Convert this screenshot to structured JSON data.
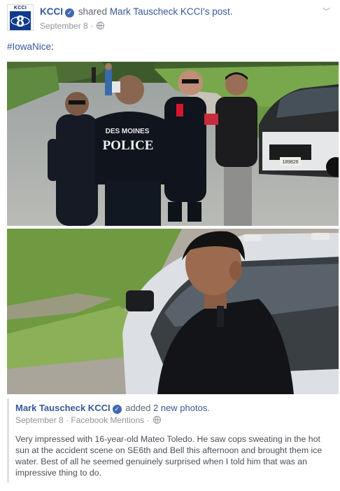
{
  "header": {
    "page_logo_text": "KCCI",
    "page_name": "KCCI",
    "shared_text": "shared",
    "author_name_part1": "Mark Tauscheck",
    "author_name_part2": "KCCI",
    "post_suffix": "'s post.",
    "date": "September 8",
    "separator": "·",
    "privacy_icon": "globe-icon",
    "menu_icon": "chevron-down-icon"
  },
  "post": {
    "hashtag": "#IowaNice",
    "hashtag_suffix": ":"
  },
  "photos": [
    {
      "alt": "Police officers in Des Moines Police uniforms receiving a drink from a teenager near police cars and caution tape",
      "sign_text": "DES MOINES",
      "sign_text2": "POLICE",
      "plate": "189826"
    },
    {
      "alt": "Close-up of a teenager in a black shirt standing next to a police car"
    }
  ],
  "shared_post": {
    "author": "Mark Tauscheck KCCI",
    "added_text": "added",
    "photos_link": "2 new photos",
    "photos_suffix": ".",
    "date": "September 8",
    "separator": "·",
    "source": "Facebook Mentions",
    "separator2": "·",
    "body": "Very impressed with 16-year-old Mateo Toledo. He saw cops sweating in the hot sun at the accident scene on SE6th and Bell this afternoon and brought them ice water. Best of all he seemed genuinely surprised when I told him that was an impressive thing to do."
  },
  "colors": {
    "link": "#365899",
    "meta": "#90949c",
    "verified": "#4267b2",
    "text": "#1d2129"
  }
}
